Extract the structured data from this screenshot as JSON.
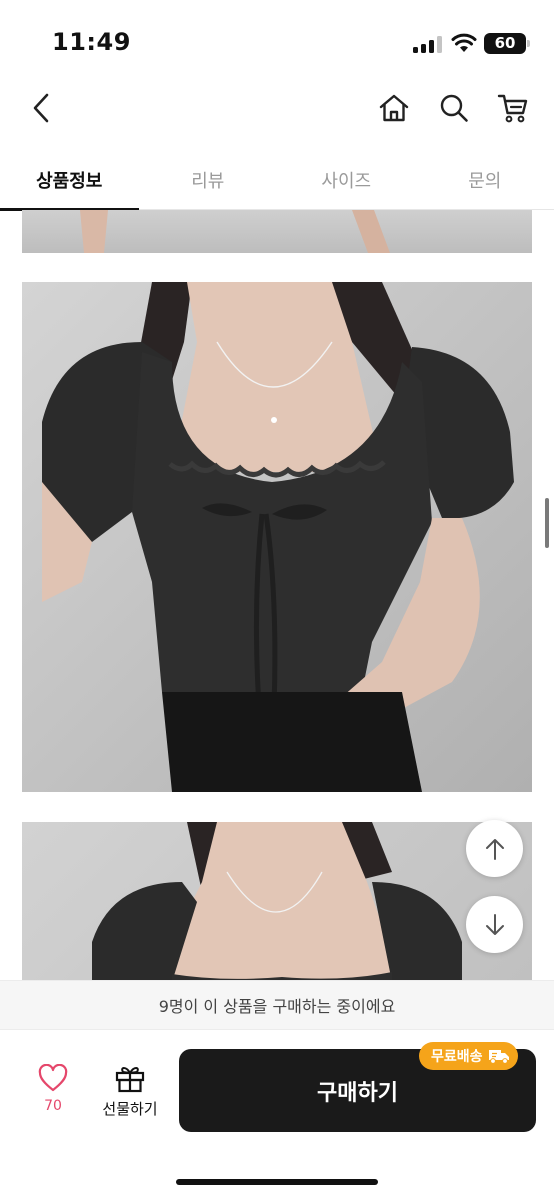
{
  "status_bar": {
    "time": "11:49",
    "battery": "60"
  },
  "nav": {
    "back_icon": "chevron-left-icon",
    "home_icon": "home-icon",
    "search_icon": "search-icon",
    "cart_icon": "cart-icon"
  },
  "tabs": [
    {
      "label": "상품정보",
      "active": true
    },
    {
      "label": "리뷰",
      "active": false
    },
    {
      "label": "사이즈",
      "active": false
    },
    {
      "label": "문의",
      "active": false
    }
  ],
  "notice": "9명이 이 상품을 구매하는 중이에요",
  "actions": {
    "like_count": "70",
    "gift_label": "선물하기",
    "buy_label": "구매하기",
    "free_shipping_badge": "무료배송"
  },
  "colors": {
    "accent_pink": "#e5476b",
    "badge_orange": "#f5a41a",
    "buy_button": "#1a1a1a"
  }
}
